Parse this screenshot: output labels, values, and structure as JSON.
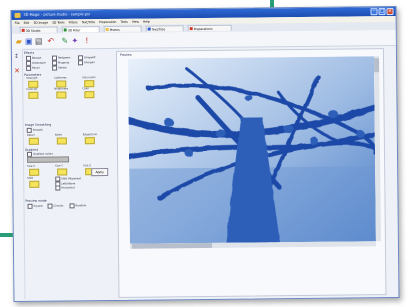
{
  "window": {
    "title": "3D Magic - picture studio - sample.psl",
    "menu": [
      "File",
      "Edit",
      "3D Image",
      "3D Tools",
      "Filters",
      "Text/Title",
      "Preparation",
      "Tools",
      "View",
      "Help"
    ],
    "tabs": [
      {
        "label": "3D Studio",
        "color": "#d23a2a"
      },
      {
        "label": "3D Filter",
        "color": "#2b8f3a"
      },
      {
        "label": "Photos",
        "color": "#e8c23a"
      },
      {
        "label": "Text/Title",
        "color": "#2f57c7"
      },
      {
        "label": "Preparations",
        "color": "#d23a2a"
      }
    ],
    "toolbar_icons": [
      "folder-open-icon",
      "save-icon",
      "print-icon",
      "undo-icon",
      "paint-icon",
      "effects-icon",
      "info-icon"
    ]
  },
  "left_panel": {
    "effect_section": "Effects",
    "effects": [
      "Blueart",
      "Redgreen",
      "Graywell",
      "Greentone",
      "Magenta",
      "Sharpen",
      "Pencil",
      "Sketch"
    ],
    "param_section": "Parameters",
    "params_row1": [
      "Strength",
      "Lightness",
      "Saturation"
    ],
    "params_row2": [
      "Contrast",
      "Brightness",
      "Color"
    ],
    "smooth_section": "Image Smoothing",
    "smooth_option": "Smooth",
    "values_row": [
      "Detail",
      "Noise",
      "Edge/Grain"
    ],
    "gradient_section": "Gradient",
    "gradient_option": "Gradient colors",
    "size_row": [
      "Size X",
      "Size Y",
      "Size Z"
    ],
    "shift_section": "Shift",
    "shift_option": "Shift Alignment",
    "shift_options2": [
      "Left/Above",
      "Horizontal"
    ],
    "preview_section": "Preview mode",
    "preview_modes": [
      "Square",
      "Circular",
      "Random"
    ],
    "apply_label": "Apply"
  },
  "canvas": {
    "label": "Preview"
  },
  "colors": {
    "window_bg": "#eef2f8",
    "titlebar": "#2f6ad6",
    "accent": "#2a9e78",
    "photo_blue": "#2d5fb8"
  }
}
